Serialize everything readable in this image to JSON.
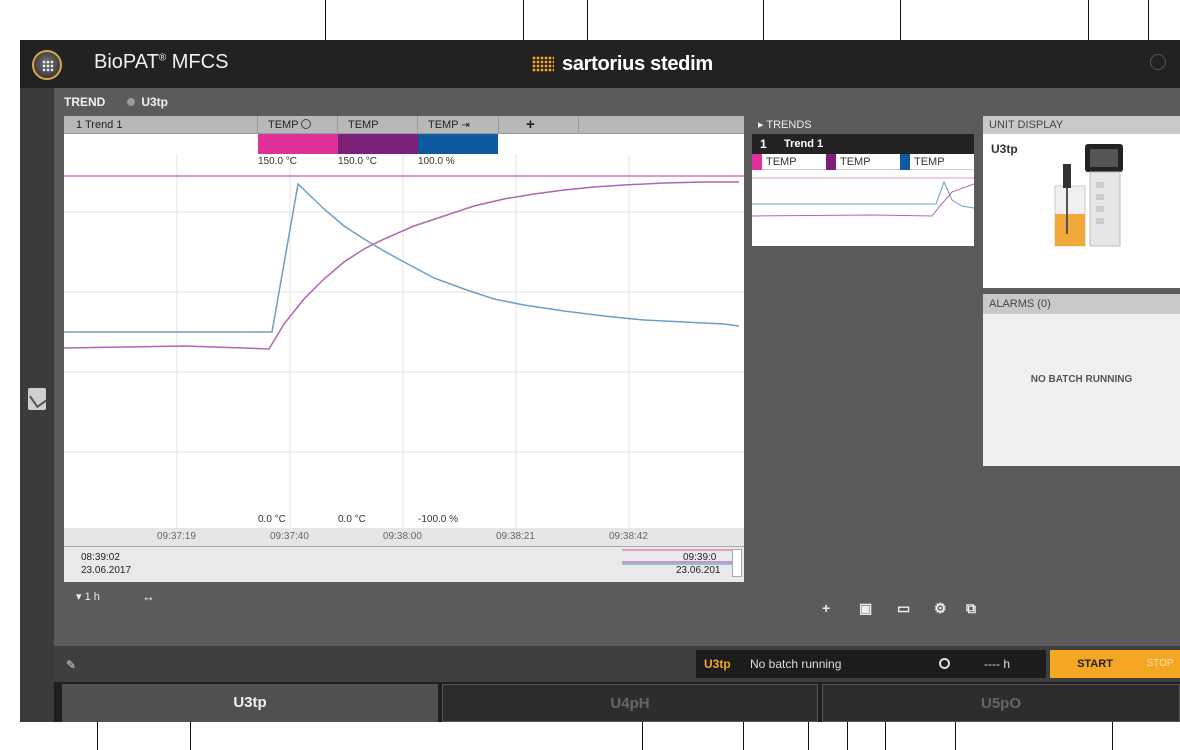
{
  "app": {
    "title": "BioPAT",
    "title_reg": "®",
    "title_suffix": " MFCS",
    "brand": "sartorius stedim",
    "brand_color": "#f5a623"
  },
  "trend_header": {
    "label": "TREND",
    "unit": "U3tp"
  },
  "trend_tabs": {
    "name": "1  Trend 1",
    "pens": [
      "TEMP",
      "TEMP",
      "TEMP"
    ],
    "add_label": "+"
  },
  "pens": [
    {
      "label": "TEMP",
      "color": "#e0309a",
      "max": "150.0 °C",
      "min": "0.0 °C"
    },
    {
      "label": "TEMP",
      "color": "#7d2079",
      "max": "150.0 °C",
      "min": "0.0 °C"
    },
    {
      "label": "TEMP",
      "color": "#0d5aa0",
      "max": "100.0 %",
      "min": "-100.0 %"
    }
  ],
  "time_axis": [
    "09:37:19",
    "09:37:40",
    "09:38:00",
    "09:38:21",
    "09:38:42"
  ],
  "overview": {
    "start_time": "08:39:02",
    "start_date": "23.06.2017",
    "end_time": "09:39:0",
    "end_date": "23.06.201"
  },
  "toolbar": {
    "zoom": "1 h",
    "pan_icon": "pan-arrows-icon"
  },
  "trends_panel": {
    "title": "TRENDS",
    "item_number": "1",
    "item_name": "Trend 1",
    "pens": [
      "TEMP",
      "TEMP",
      "TEMP"
    ]
  },
  "unit_display": {
    "title": "UNIT DISPLAY",
    "unit": "U3tp"
  },
  "alarms": {
    "title": "ALARMS (0)",
    "message": "NO BATCH RUNNING"
  },
  "status_bar": {
    "unit": "U3tp",
    "batch_status": "No batch running",
    "hours": "---- h",
    "start_label": "START",
    "stop_label": "STOP"
  },
  "unit_tabs": [
    "U3tp",
    "U4pH",
    "U5pO"
  ],
  "icons": [
    "menu-icon",
    "power-icon",
    "clipboard-icon",
    "add-icon",
    "save-icon",
    "folder-icon",
    "settings-icon",
    "layout-icon",
    "clock-icon",
    "edit-icon"
  ]
}
